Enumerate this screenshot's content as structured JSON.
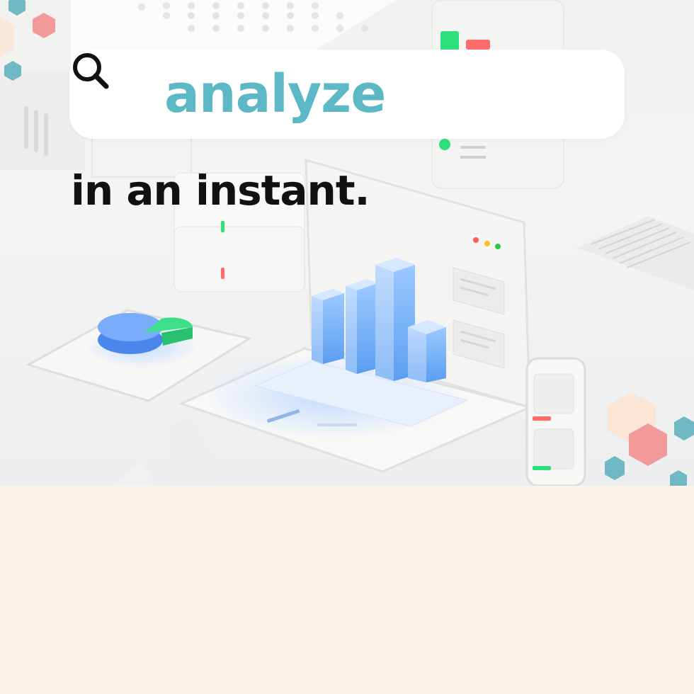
{
  "search": {
    "query": "analyze",
    "icon": "search-icon"
  },
  "headline": {
    "text": "in an instant."
  },
  "illustration": {
    "scene": "isometric-analytics-desk",
    "icons": [
      "laptop-icon",
      "bar-chart-icon",
      "pie-chart-icon",
      "server-icon",
      "phone-icon",
      "hexagon-icon"
    ]
  },
  "colors": {
    "query_text": "#5bb8c4",
    "headline_text": "#111111",
    "search_icon": "#111111",
    "bottom_panel": "#fdf4e9",
    "hex_teal": "#6fb8c4",
    "hex_coral": "#f2999a",
    "hex_cream": "#fbe6d6",
    "bar_blue": "#7ab4f6",
    "pie_green": "#3de08a"
  }
}
